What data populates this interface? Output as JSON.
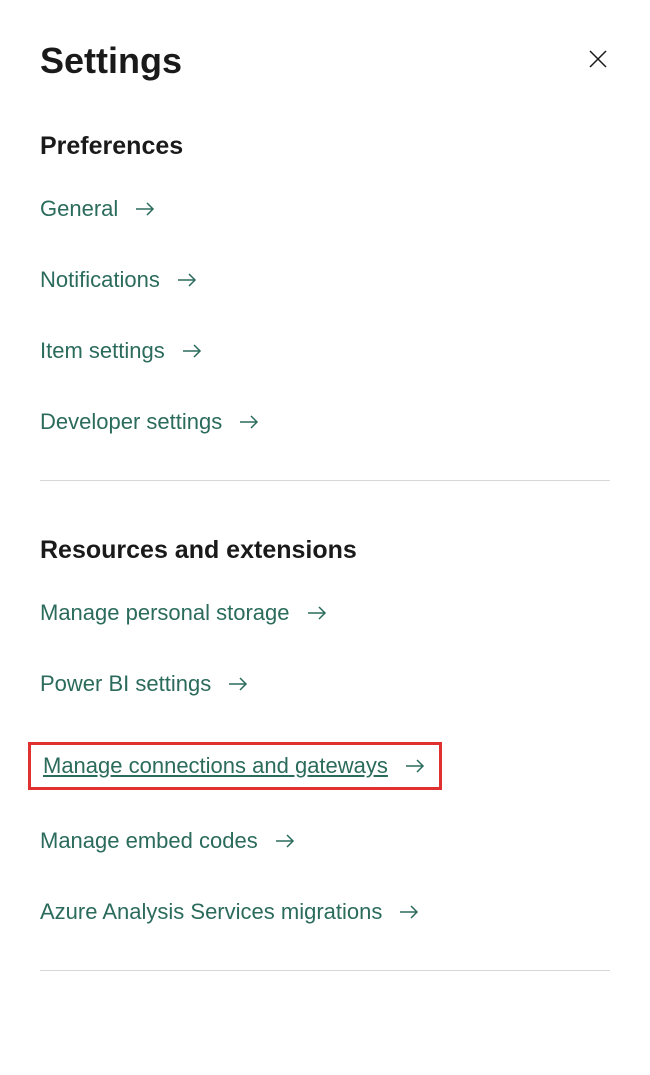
{
  "header": {
    "title": "Settings"
  },
  "sections": {
    "preferences": {
      "title": "Preferences",
      "items": {
        "general": "General",
        "notifications": "Notifications",
        "item_settings": "Item settings",
        "developer_settings": "Developer settings"
      }
    },
    "resources": {
      "title": "Resources and extensions",
      "items": {
        "manage_personal_storage": "Manage personal storage",
        "power_bi_settings": "Power BI settings",
        "manage_connections_gateways": "Manage connections and gateways",
        "manage_embed_codes": "Manage embed codes",
        "azure_analysis_migrations": "Azure Analysis Services migrations"
      }
    }
  }
}
